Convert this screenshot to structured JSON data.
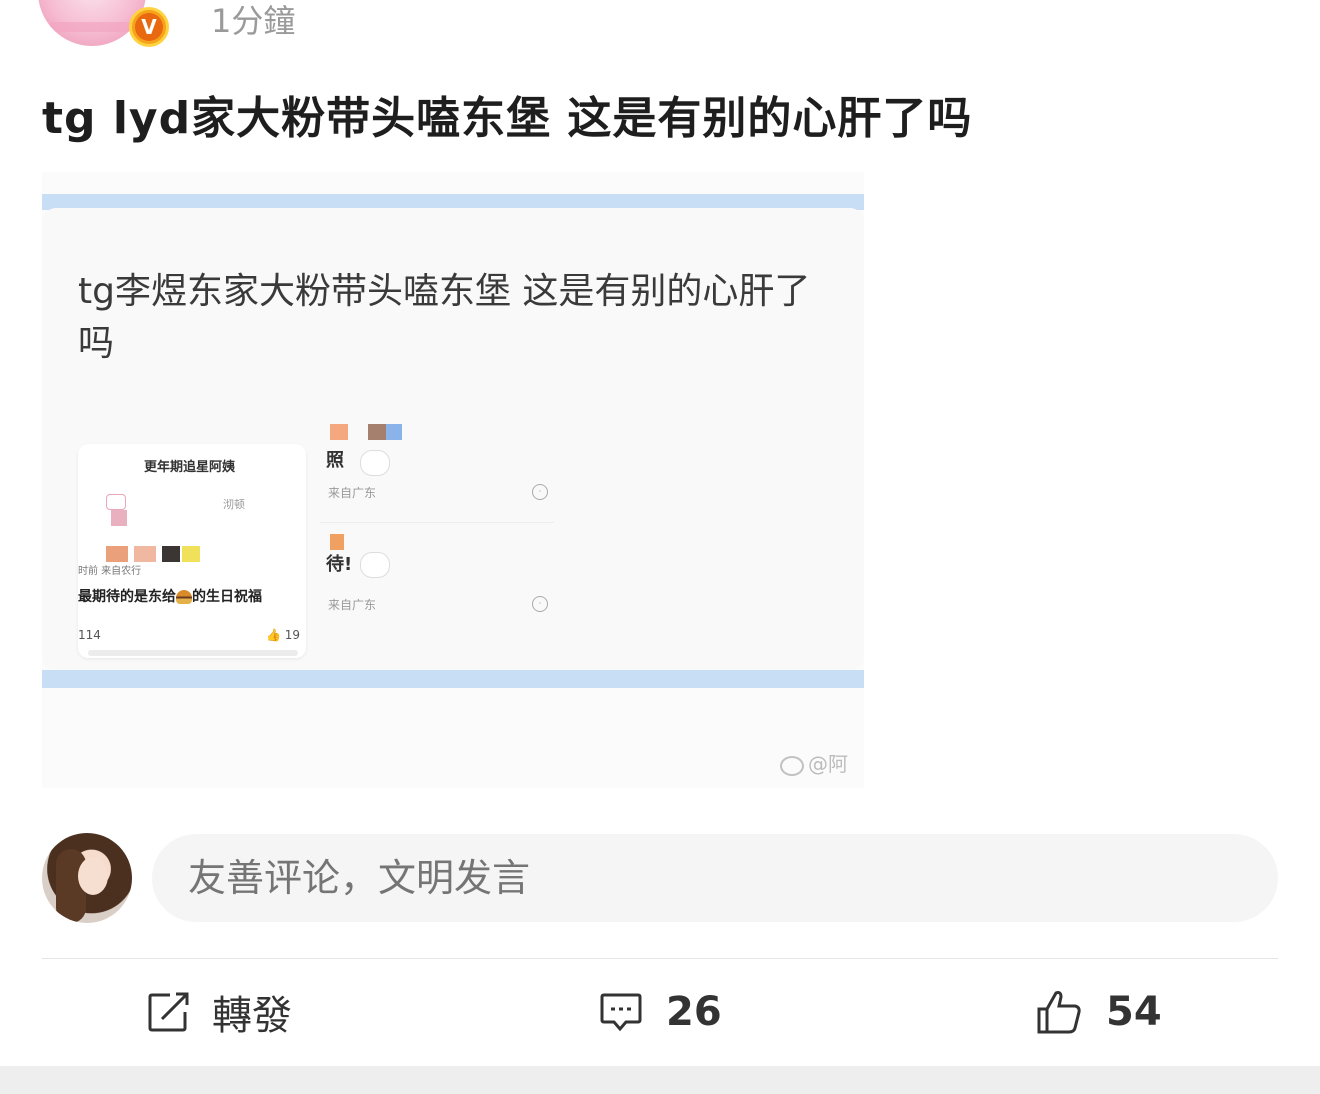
{
  "post": {
    "time": "1分鐘",
    "verified_badge_letter": "V",
    "title": "tg lyd家大粉带头嗑东堡 这是有别的心肝了吗"
  },
  "embedded_image": {
    "title": "tg李煜东家大粉带头嗑东堡 这是有别的心肝了吗",
    "comment_card": {
      "name": "更年期追星阿姨",
      "follow": "沏顿",
      "meta": "时前 来自农行",
      "text_before": "最期待的是东给",
      "text_after": "的生日祝福",
      "comments_count": "114",
      "likes_count": "19"
    },
    "side_comments": [
      {
        "text": "照",
        "location": "来自广东"
      },
      {
        "text": "待!",
        "location": "来自广东"
      }
    ],
    "watermark": "@阿"
  },
  "composer": {
    "placeholder": "友善评论，文明发言"
  },
  "actions": {
    "repost_label": "轉發",
    "comments_count": "26",
    "likes_count": "54"
  },
  "colors": {
    "accent_blue": "#c7def4",
    "badge_orange": "#f7a21b"
  },
  "icons": [
    "verified-icon",
    "repost-icon",
    "comment-icon",
    "like-icon",
    "weibo-logo-icon",
    "emoji-icon"
  ]
}
